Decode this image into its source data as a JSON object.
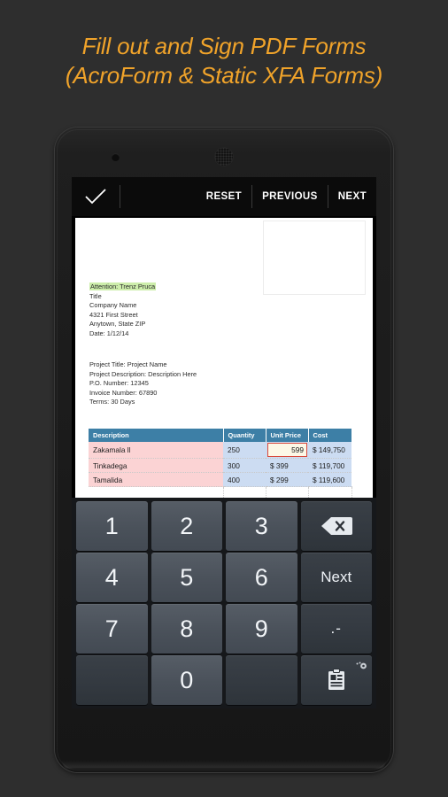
{
  "headline": {
    "line1": "Fill out and Sign PDF Forms",
    "line2": "(AcroForm & Static XFA Forms)",
    "color": "#f0a32a"
  },
  "device": {
    "camera_icon": "camera-icon",
    "speaker_icon": "earpiece-speaker-icon"
  },
  "app": {
    "toolbar": {
      "confirm_icon": "checkmark-icon",
      "reset_label": "RESET",
      "previous_label": "PREVIOUS",
      "next_label": "NEXT"
    },
    "document": {
      "address_block": "Attention: Trenz Pruca\nTitle\nCompany Name\n4321 First Street\nAnytown, State ZIP\nDate: 1/12/14",
      "attention_label": "Attention: Trenz Pruca",
      "attention_highlight_color": "#cdeeab",
      "address_rest": "Title\nCompany Name\n4321 First Street\nAnytown, State ZIP\nDate: 1/12/14",
      "project_block": "Project Title: Project Name\nProject Description: Description Here\nP.O. Number: 12345\nInvoice Number: 67890\nTerms: 30 Days",
      "table": {
        "header_color": "#3d7fa6",
        "headers": [
          "Description",
          "Quantity",
          "Unit Price",
          "Cost"
        ],
        "rows": [
          {
            "description": "Zakamala ll",
            "quantity": "250",
            "unit_price": "599",
            "cost": "$ 149,750",
            "price_is_active_field": true
          },
          {
            "description": "Tinkadega",
            "quantity": "300",
            "unit_price": "$ 399",
            "cost": "$ 119,700",
            "price_is_active_field": false
          },
          {
            "description": "Tamalida",
            "quantity": "400",
            "unit_price": "$ 299",
            "cost": "$ 119,600",
            "price_is_active_field": false
          }
        ],
        "active_field_value": "599",
        "active_field_border_color": "#d8493c",
        "active_field_bg_color": "#fdf8e6",
        "desc_cell_color": "#fbd3d4",
        "value_cell_color": "#ccdcf2"
      }
    },
    "keyboard": {
      "row1": [
        "1",
        "2",
        "3"
      ],
      "row2": [
        "4",
        "5",
        "6"
      ],
      "row3": [
        "7",
        "8",
        "9"
      ],
      "row4_zero": "0",
      "backspace_icon": "backspace-icon",
      "next_label": "Next",
      "dot_dash_label": ".-",
      "clipboard_icon": "clipboard-icon",
      "gear_icon": "gear-icon"
    }
  }
}
